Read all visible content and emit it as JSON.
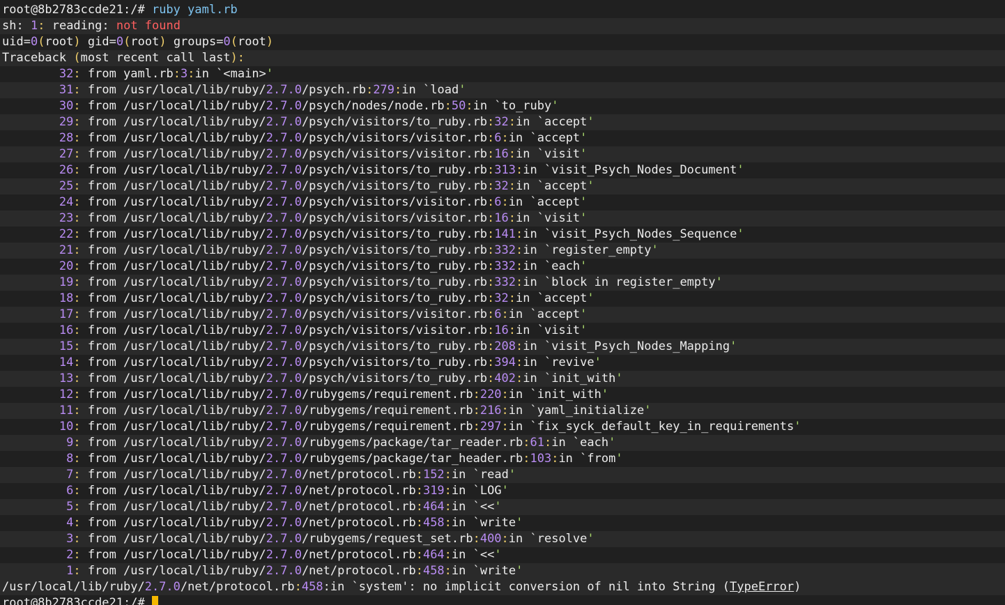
{
  "window": {
    "title": "root@8b2783ccde21:/"
  },
  "colors": {
    "background": "#202020",
    "text": "#ececec",
    "number": "#b98cf3",
    "punctuation": "#f0cf6b",
    "string": "#a8d66b",
    "command": "#7fc4f0",
    "error": "#ff5f5f",
    "cursor": "#f5b800"
  },
  "prompt": {
    "text": "root@8b2783ccde21:/#",
    "command": "ruby yaml.rb"
  },
  "sh_error": {
    "prefix": "sh:",
    "num": "1",
    "word": "reading:",
    "msg": "not found"
  },
  "uid_line": {
    "uid_label": "uid=",
    "uid_num": "0",
    "uid_name": "root",
    "gid_label": "gid=",
    "gid_num": "0",
    "gid_name": "root",
    "groups_label": "groups=",
    "groups_num": "0",
    "groups_name": "root"
  },
  "traceback": {
    "label": "Traceback",
    "paren_text": "most recent call last",
    "frames": [
      {
        "n": "32",
        "dir": "",
        "ver": "",
        "file": "yaml.rb",
        "line": "3",
        "method": "<main>"
      },
      {
        "n": "31",
        "dir": "/usr/local/lib/ruby/",
        "ver": "2.7.0",
        "file": "/psych.rb",
        "line": "279",
        "method": "load"
      },
      {
        "n": "30",
        "dir": "/usr/local/lib/ruby/",
        "ver": "2.7.0",
        "file": "/psych/nodes/node.rb",
        "line": "50",
        "method": "to_ruby"
      },
      {
        "n": "29",
        "dir": "/usr/local/lib/ruby/",
        "ver": "2.7.0",
        "file": "/psych/visitors/to_ruby.rb",
        "line": "32",
        "method": "accept"
      },
      {
        "n": "28",
        "dir": "/usr/local/lib/ruby/",
        "ver": "2.7.0",
        "file": "/psych/visitors/visitor.rb",
        "line": "6",
        "method": "accept"
      },
      {
        "n": "27",
        "dir": "/usr/local/lib/ruby/",
        "ver": "2.7.0",
        "file": "/psych/visitors/visitor.rb",
        "line": "16",
        "method": "visit"
      },
      {
        "n": "26",
        "dir": "/usr/local/lib/ruby/",
        "ver": "2.7.0",
        "file": "/psych/visitors/to_ruby.rb",
        "line": "313",
        "method": "visit_Psych_Nodes_Document"
      },
      {
        "n": "25",
        "dir": "/usr/local/lib/ruby/",
        "ver": "2.7.0",
        "file": "/psych/visitors/to_ruby.rb",
        "line": "32",
        "method": "accept"
      },
      {
        "n": "24",
        "dir": "/usr/local/lib/ruby/",
        "ver": "2.7.0",
        "file": "/psych/visitors/visitor.rb",
        "line": "6",
        "method": "accept"
      },
      {
        "n": "23",
        "dir": "/usr/local/lib/ruby/",
        "ver": "2.7.0",
        "file": "/psych/visitors/visitor.rb",
        "line": "16",
        "method": "visit"
      },
      {
        "n": "22",
        "dir": "/usr/local/lib/ruby/",
        "ver": "2.7.0",
        "file": "/psych/visitors/to_ruby.rb",
        "line": "141",
        "method": "visit_Psych_Nodes_Sequence"
      },
      {
        "n": "21",
        "dir": "/usr/local/lib/ruby/",
        "ver": "2.7.0",
        "file": "/psych/visitors/to_ruby.rb",
        "line": "332",
        "method": "register_empty"
      },
      {
        "n": "20",
        "dir": "/usr/local/lib/ruby/",
        "ver": "2.7.0",
        "file": "/psych/visitors/to_ruby.rb",
        "line": "332",
        "method": "each"
      },
      {
        "n": "19",
        "dir": "/usr/local/lib/ruby/",
        "ver": "2.7.0",
        "file": "/psych/visitors/to_ruby.rb",
        "line": "332",
        "method": "block in register_empty"
      },
      {
        "n": "18",
        "dir": "/usr/local/lib/ruby/",
        "ver": "2.7.0",
        "file": "/psych/visitors/to_ruby.rb",
        "line": "32",
        "method": "accept"
      },
      {
        "n": "17",
        "dir": "/usr/local/lib/ruby/",
        "ver": "2.7.0",
        "file": "/psych/visitors/visitor.rb",
        "line": "6",
        "method": "accept"
      },
      {
        "n": "16",
        "dir": "/usr/local/lib/ruby/",
        "ver": "2.7.0",
        "file": "/psych/visitors/visitor.rb",
        "line": "16",
        "method": "visit"
      },
      {
        "n": "15",
        "dir": "/usr/local/lib/ruby/",
        "ver": "2.7.0",
        "file": "/psych/visitors/to_ruby.rb",
        "line": "208",
        "method": "visit_Psych_Nodes_Mapping"
      },
      {
        "n": "14",
        "dir": "/usr/local/lib/ruby/",
        "ver": "2.7.0",
        "file": "/psych/visitors/to_ruby.rb",
        "line": "394",
        "method": "revive"
      },
      {
        "n": "13",
        "dir": "/usr/local/lib/ruby/",
        "ver": "2.7.0",
        "file": "/psych/visitors/to_ruby.rb",
        "line": "402",
        "method": "init_with"
      },
      {
        "n": "12",
        "dir": "/usr/local/lib/ruby/",
        "ver": "2.7.0",
        "file": "/rubygems/requirement.rb",
        "line": "220",
        "method": "init_with"
      },
      {
        "n": "11",
        "dir": "/usr/local/lib/ruby/",
        "ver": "2.7.0",
        "file": "/rubygems/requirement.rb",
        "line": "216",
        "method": "yaml_initialize"
      },
      {
        "n": "10",
        "dir": "/usr/local/lib/ruby/",
        "ver": "2.7.0",
        "file": "/rubygems/requirement.rb",
        "line": "297",
        "method": "fix_syck_default_key_in_requirements"
      },
      {
        "n": " 9",
        "dir": "/usr/local/lib/ruby/",
        "ver": "2.7.0",
        "file": "/rubygems/package/tar_reader.rb",
        "line": "61",
        "method": "each"
      },
      {
        "n": " 8",
        "dir": "/usr/local/lib/ruby/",
        "ver": "2.7.0",
        "file": "/rubygems/package/tar_header.rb",
        "line": "103",
        "method": "from"
      },
      {
        "n": " 7",
        "dir": "/usr/local/lib/ruby/",
        "ver": "2.7.0",
        "file": "/net/protocol.rb",
        "line": "152",
        "method": "read"
      },
      {
        "n": " 6",
        "dir": "/usr/local/lib/ruby/",
        "ver": "2.7.0",
        "file": "/net/protocol.rb",
        "line": "319",
        "method": "LOG"
      },
      {
        "n": " 5",
        "dir": "/usr/local/lib/ruby/",
        "ver": "2.7.0",
        "file": "/net/protocol.rb",
        "line": "464",
        "method": "<<"
      },
      {
        "n": " 4",
        "dir": "/usr/local/lib/ruby/",
        "ver": "2.7.0",
        "file": "/net/protocol.rb",
        "line": "458",
        "method": "write"
      },
      {
        "n": " 3",
        "dir": "/usr/local/lib/ruby/",
        "ver": "2.7.0",
        "file": "/rubygems/request_set.rb",
        "line": "400",
        "method": "resolve"
      },
      {
        "n": " 2",
        "dir": "/usr/local/lib/ruby/",
        "ver": "2.7.0",
        "file": "/net/protocol.rb",
        "line": "464",
        "method": "<<"
      },
      {
        "n": " 1",
        "dir": "/usr/local/lib/ruby/",
        "ver": "2.7.0",
        "file": "/net/protocol.rb",
        "line": "458",
        "method": "write"
      }
    ]
  },
  "error_line": {
    "dir": "/usr/local/lib/ruby/",
    "ver": "2.7.0",
    "file": "/net/protocol.rb",
    "line": "458",
    "in_text": ":in `system': no implicit conversion of nil into String (",
    "error_class": "TypeError",
    "close": ")"
  },
  "final_prompt": {
    "text": "root@8b2783ccde21:/#"
  }
}
